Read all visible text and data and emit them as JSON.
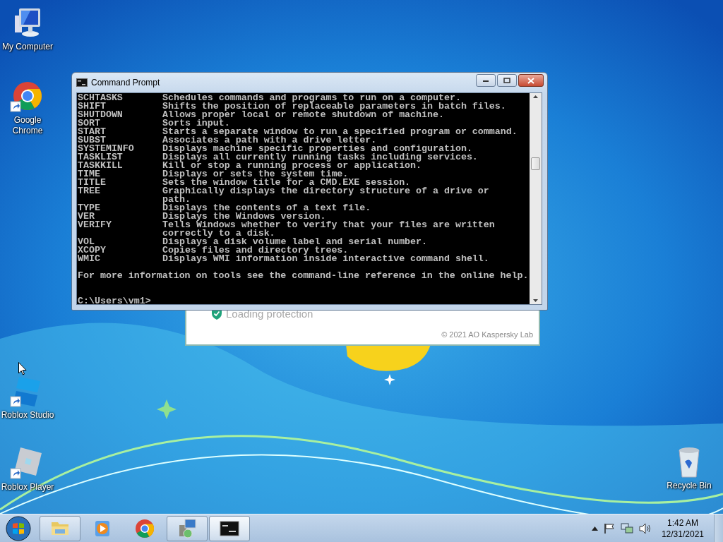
{
  "desktop_icons": [
    {
      "kind": "computer",
      "label": "My Computer",
      "shortcut": false
    },
    {
      "kind": "chrome",
      "label": "Google Chrome",
      "shortcut": true
    },
    {
      "kind": "roblox-studio",
      "label": "Roblox Studio",
      "shortcut": true
    },
    {
      "kind": "roblox-player",
      "label": "Roblox Player",
      "shortcut": true
    },
    {
      "kind": "recycle-bin",
      "label": "Recycle Bin",
      "shortcut": false
    }
  ],
  "kaspersky_window": {
    "status": "Loading protection",
    "copyright": "© 2021 AO Kaspersky Lab"
  },
  "cmd_window": {
    "title": "Command Prompt",
    "lines": [
      {
        "command": "SCHTASKS",
        "description": "Schedules commands and programs to run on a computer."
      },
      {
        "command": "SHIFT",
        "description": "Shifts the position of replaceable parameters in batch files."
      },
      {
        "command": "SHUTDOWN",
        "description": "Allows proper local or remote shutdown of machine."
      },
      {
        "command": "SORT",
        "description": "Sorts input."
      },
      {
        "command": "START",
        "description": "Starts a separate window to run a specified program or command."
      },
      {
        "command": "SUBST",
        "description": "Associates a path with a drive letter."
      },
      {
        "command": "SYSTEMINFO",
        "description": "Displays machine specific properties and configuration."
      },
      {
        "command": "TASKLIST",
        "description": "Displays all currently running tasks including services."
      },
      {
        "command": "TASKKILL",
        "description": "Kill or stop a running process or application."
      },
      {
        "command": "TIME",
        "description": "Displays or sets the system time."
      },
      {
        "command": "TITLE",
        "description": "Sets the window title for a CMD.EXE session."
      },
      {
        "command": "TREE",
        "description": "Graphically displays the directory structure of a drive or"
      },
      {
        "description": "path."
      },
      {
        "command": "TYPE",
        "description": "Displays the contents of a text file."
      },
      {
        "command": "VER",
        "description": "Displays the Windows version."
      },
      {
        "command": "VERIFY",
        "description": "Tells Windows whether to verify that your files are written"
      },
      {
        "description": "correctly to a disk."
      },
      {
        "command": "VOL",
        "description": "Displays a disk volume label and serial number."
      },
      {
        "command": "XCOPY",
        "description": "Copies files and directory trees."
      },
      {
        "command": "WMIC",
        "description": "Displays WMI information inside interactive command shell."
      }
    ],
    "footer": "For more information on tools see the command-line reference in the online help.",
    "prompt": "C:\\Users\\vm1>"
  },
  "taskbar": {
    "buttons": [
      {
        "kind": "explorer",
        "running": true,
        "active": false
      },
      {
        "kind": "media-player",
        "running": false,
        "active": false
      },
      {
        "kind": "chrome",
        "running": false,
        "active": false
      },
      {
        "kind": "installer",
        "running": true,
        "active": false
      },
      {
        "kind": "console",
        "running": true,
        "active": true
      }
    ],
    "clock": {
      "time": "1:42 AM",
      "date": "12/31/2021"
    }
  }
}
